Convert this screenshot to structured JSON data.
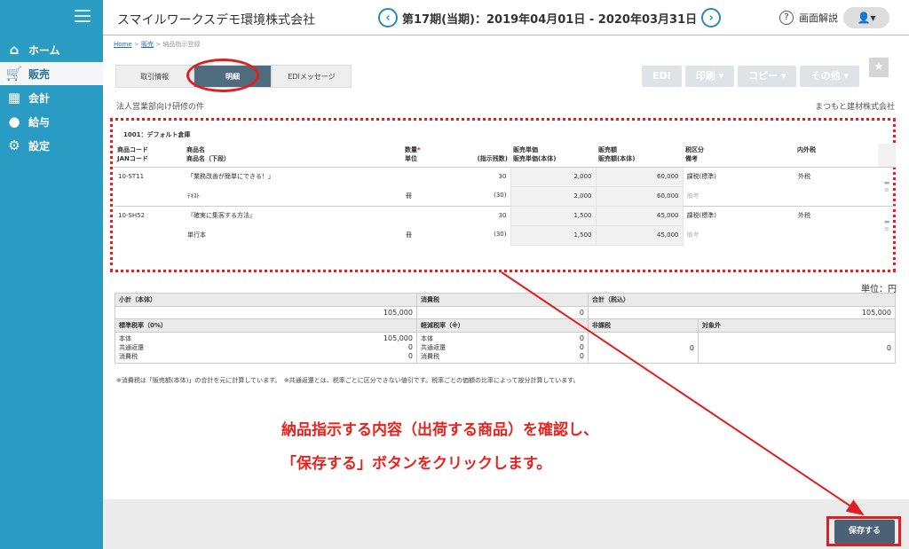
{
  "sidebar": {
    "items": [
      {
        "label": "ホーム",
        "icon": "home-icon",
        "glyph": "⌂"
      },
      {
        "label": "販売",
        "icon": "cart-icon",
        "glyph": "🛒"
      },
      {
        "label": "会計",
        "icon": "calculator-icon",
        "glyph": "▦"
      },
      {
        "label": "給与",
        "icon": "money-bag-icon",
        "glyph": "●"
      },
      {
        "label": "設定",
        "icon": "gear-icon",
        "glyph": "⚙"
      }
    ]
  },
  "header": {
    "company": "スマイルワークスデモ環境株式会社",
    "period": "第17期(当期)：2019年04月01日 - 2020年03月31日",
    "prev": "‹",
    "next": "›",
    "help": "画面解説",
    "user": "👤▾"
  },
  "breadcrumb": {
    "home": "Home",
    "sales": "販売",
    "current": "納品指示登録",
    "sep": ">"
  },
  "tabs": [
    "取引情報",
    "明細",
    "EDIメッセージ"
  ],
  "toolbar": {
    "edi": "EDI",
    "print": "印刷 ▾",
    "copy": "コピー ▾",
    "other": "その他 ▾",
    "star": "★"
  },
  "subject": "法人営業部向け研修の件",
  "supplier": "まつもと建材株式会社",
  "warehouse": "1001：デフォルト倉庫",
  "table": {
    "headers": {
      "code": "商品コード",
      "jan": "JANコード",
      "name": "商品名",
      "name_sub": "商品名（下段）",
      "qty": "数量",
      "req": "*",
      "unit": "単位",
      "remain": "(指示残数)",
      "price": "販売単価",
      "price_sub": "販売単価(本体)",
      "amount": "販売額",
      "amount_sub": "販売額(本体)",
      "tax": "税区分",
      "memo": "備考",
      "inout": "内外税"
    },
    "rows": [
      {
        "code": "10-ST11",
        "name": "「業務改善が簡単にできる！」",
        "name_sub": "ﾃｷｽﾄ",
        "qty": "30",
        "unit": "冊",
        "remain": "(30)",
        "price": "2,000",
        "price_body": "2,000",
        "amount": "60,000",
        "amount_body": "60,000",
        "tax": "課税(標準)",
        "memo": "備考",
        "inout": "外税"
      },
      {
        "code": "10-SH52",
        "name": "『確実に集客する方法』",
        "name_sub": "単行本",
        "qty": "30",
        "unit": "冊",
        "remain": "(30)",
        "price": "1,500",
        "price_body": "1,500",
        "amount": "45,000",
        "amount_body": "45,000",
        "tax": "課税(標準)",
        "memo": "備考",
        "inout": "外税"
      }
    ]
  },
  "unit_label": "単位：円",
  "summary": {
    "subtotal_label": "小計（本体）",
    "subtotal": "105,000",
    "tax_label": "消費税",
    "tax": "0",
    "total_label": "合計（税込）",
    "total": "105,000",
    "std_label": "標準税率（0%）",
    "reduced_label": "軽減税率（※）",
    "nontax_label": "非課税",
    "exempt_label": "対象外",
    "body_label": "本体",
    "common_label": "共通返還",
    "ctax_label": "消費税",
    "std_body": "105,000",
    "std_common": "0",
    "std_tax": "0",
    "red_body": "0",
    "red_common": "0",
    "red_tax": "0",
    "nontax": "0",
    "exempt": "0"
  },
  "notes": "※消費税は「販売額(本体)」の合計を元に計算しています。　※共通返還とは、税率ごとに区分できない値引です。税率ごとの価額の比率によって按分計算しています。",
  "instruction": {
    "line1": "納品指示する内容（出荷する商品）を確認し、",
    "line2": "「保存する」ボタンをクリックします。"
  },
  "save": "保存する",
  "colors": {
    "sidebar": "#2a9bc2",
    "accent_red": "#e02020",
    "save_button": "#4a6176"
  }
}
